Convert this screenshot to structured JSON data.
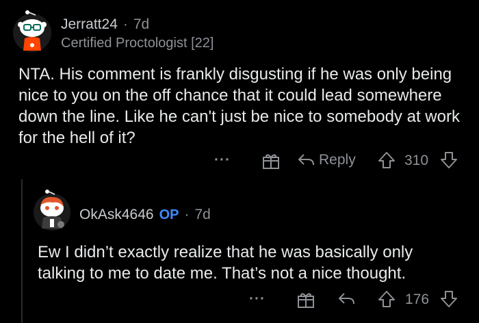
{
  "comment": {
    "username": "Jerratt24",
    "separator": "·",
    "age": "7d",
    "flair": "Certified Proctologist [22]",
    "body": "NTA. His comment is frankly disgusting if he was only being nice to you on the off chance that it could lead somewhere down the line. Like he can't just be nice to somebody at work for the hell of it?",
    "actions": {
      "more": "···",
      "reply_label": "Reply",
      "votes": "310"
    }
  },
  "reply": {
    "username": "OkAsk4646",
    "op_badge": "OP",
    "separator": "·",
    "age": "7d",
    "body": "Ew I didn’t exactly realize that he was basically only talking to me to date me. That’s not a nice thought.",
    "actions": {
      "more": "···",
      "votes": "176"
    }
  },
  "colors": {
    "background": "#000000",
    "text": "#e8eaec",
    "muted": "#8e9297",
    "op_blue": "#3d8bff",
    "avatar_orange": "#ff4500"
  }
}
